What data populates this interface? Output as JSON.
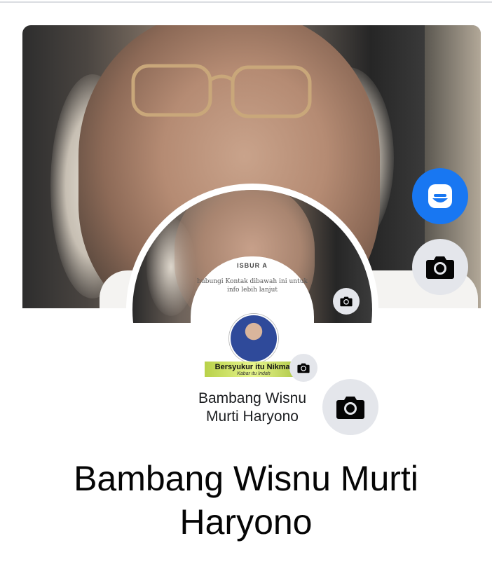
{
  "cover": {
    "photo_label": "cover-photo"
  },
  "buttons": {
    "avatar_icon": "avatar-icon",
    "cover_camera_icon": "camera-icon",
    "profile_camera_icon": "camera-icon"
  },
  "profile_picture": {
    "heading": "ISBUR A",
    "subtext": "hubungi Kontak dibawah ini untuk info lebih lanjut",
    "banner_text": "Bersyukur itu Nikmat",
    "banner_sub": "Kabar itu Indah",
    "inner_name": "Bambang Wisnu Murti Haryono"
  },
  "profile": {
    "name": "Bambang Wisnu Murti Haryono"
  },
  "colors": {
    "accent": "#1877f2",
    "button_bg": "#e4e6eb",
    "text": "#050505"
  }
}
